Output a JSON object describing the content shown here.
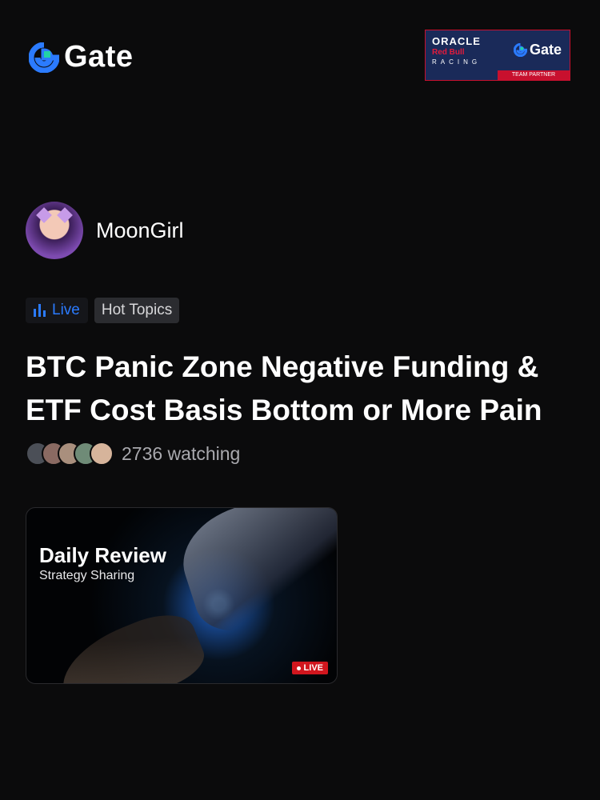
{
  "brand": {
    "logo_text": "Gate",
    "accent": "#2b7bff"
  },
  "partner_banner": {
    "line1": "ORACLE",
    "line2": "Red Bull",
    "line3": "RACING",
    "gate_text": "Gate",
    "badge": "TEAM PARTNER"
  },
  "host": {
    "name": "MoonGirl",
    "avatar_icon": "anime-girl-avatar"
  },
  "tags": {
    "live_label": "Live",
    "topic_label": "Hot Topics"
  },
  "stream": {
    "title": "BTC Panic Zone  Negative Funding & ETF Cost Basis Bottom or More Pain",
    "watching_text": "2736 watching",
    "thumbnail": {
      "title": "Daily Review",
      "subtitle": "Strategy Sharing",
      "live_badge": "LIVE"
    }
  }
}
